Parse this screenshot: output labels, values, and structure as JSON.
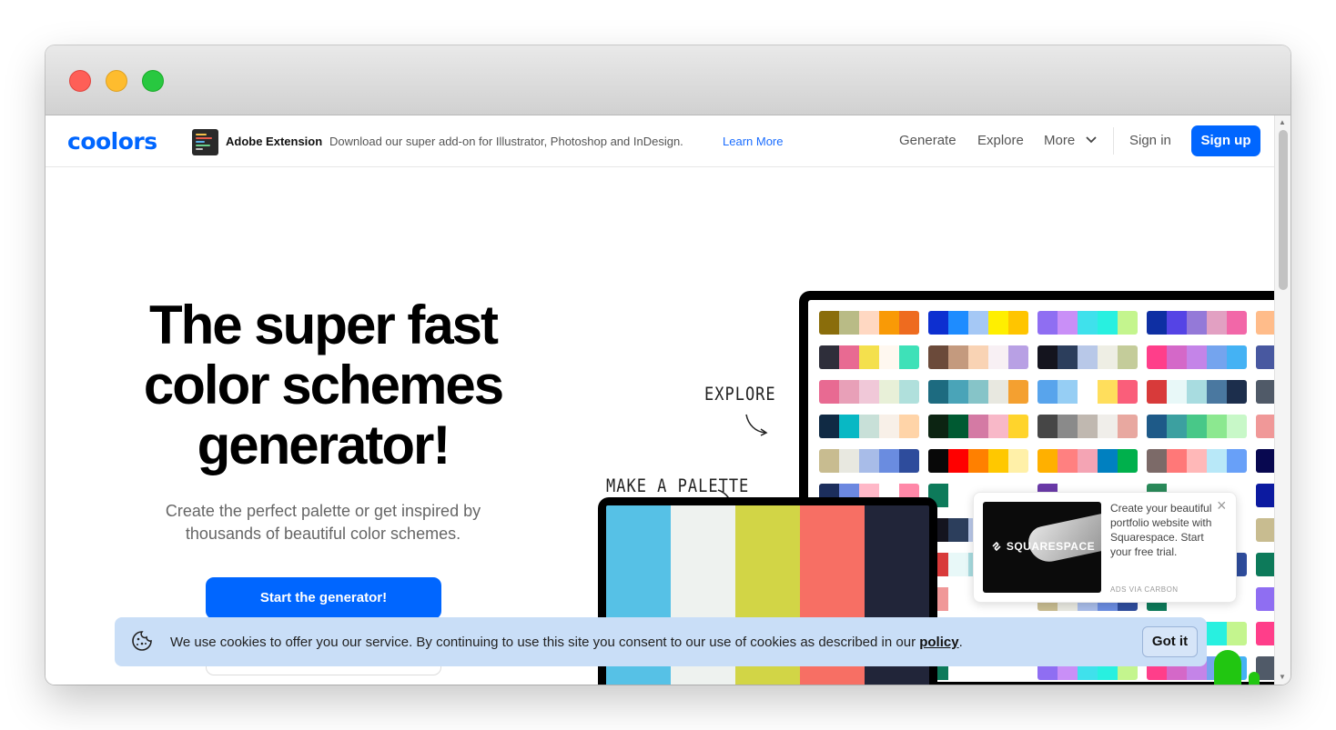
{
  "nav": {
    "logo": "coolors",
    "extension_title": "Adobe Extension",
    "extension_desc": "Download our super add-on for Illustrator, Photoshop and InDesign.",
    "extension_link": "Learn More",
    "links": [
      "Generate",
      "Explore",
      "More"
    ],
    "sign_in": "Sign in",
    "sign_up": "Sign up"
  },
  "hero": {
    "title_line1": "The super fast",
    "title_line2": "color schemes",
    "title_line3": "generator!",
    "subtitle_line1": "Create the perfect palette or get inspired by",
    "subtitle_line2": "thousands of beautiful color schemes.",
    "cta": "Start the generator!"
  },
  "illustration": {
    "label_explore": "EXPLORE",
    "label_make": "MAKE A PALETTE",
    "palette_colors": [
      "#56c1e6",
      "#eef2ef",
      "#d2d546",
      "#f76f64",
      "#212539"
    ],
    "grid": [
      [
        [
          "#8a6d0b",
          "#b9bb86",
          "#ffd8c2",
          "#f99a06",
          "#ee6b1f"
        ],
        [
          "#0d2fd0",
          "#1e8cff",
          "#a5c8f5",
          "#ffef00",
          "#ffc500"
        ],
        [
          "#8f6ef2",
          "#c98ff7",
          "#3fe1ec",
          "#28f0e0",
          "#c4f58e"
        ],
        [
          "#0e2fa3",
          "#5544e5",
          "#9479d8",
          "#e2a0c2",
          "#f267a8"
        ],
        [
          "#ffbc8a",
          "#f5e0c9",
          "#fff",
          "#fff",
          "#fff"
        ]
      ],
      [
        [
          "#2e2e3a",
          "#e86a92",
          "#f4e04d",
          "#fff8f0",
          "#3ee1b8"
        ],
        [
          "#6b4a3a",
          "#c49a7e",
          "#f9d3b4",
          "#f8f0f4",
          "#b8a0e4"
        ],
        [
          "#14141e",
          "#2c3e5c",
          "#b8c8e8",
          "#eeeee4",
          "#c4cc9a"
        ],
        [
          "#ff3e8a",
          "#d468c8",
          "#c484e8",
          "#74a4ee",
          "#44b2f4"
        ],
        [
          "#4858a0",
          "#fff",
          "#fff",
          "#fff",
          "#fff"
        ]
      ],
      [
        [
          "#e86a92",
          "#e8a0b8",
          "#f0c8d8",
          "#e8f0d8",
          "#b0e0dc"
        ],
        [
          "#1d6b80",
          "#4aa4b8",
          "#86c4c8",
          "#e8e8e0",
          "#f4a030"
        ],
        [
          "#58a4ec",
          "#96cef4",
          "#fff",
          "#ffde5c",
          "#fa5e7a"
        ],
        [
          "#d83a3a",
          "#e8f8f8",
          "#a8dce0",
          "#4a78a0",
          "#1c2e4c"
        ],
        [
          "#505a68",
          "#fff",
          "#fff",
          "#fff",
          "#fff"
        ]
      ],
      [
        [
          "#102a44",
          "#08b8c4",
          "#c8e0d8",
          "#f8f0e8",
          "#ffd4a8"
        ],
        [
          "#0c2412",
          "#005a32",
          "#d47aa4",
          "#f8b8c8",
          "#ffd42c"
        ],
        [
          "#464646",
          "#8a8a8a",
          "#c0b8b0",
          "#f0eeea",
          "#e8a8a0"
        ],
        [
          "#1e5a88",
          "#3ca0a0",
          "#48c888",
          "#8ce890",
          "#c8f8c8"
        ],
        [
          "#f09898",
          "#fff",
          "#fff",
          "#fff",
          "#fff"
        ]
      ],
      [
        [
          "#c8bc90",
          "#e8e8e0",
          "#a8bce8",
          "#6a8ce0",
          "#2e4c9c"
        ],
        [
          "#080808",
          "#ff0000",
          "#ff8000",
          "#ffc800",
          "#fff0a8"
        ],
        [
          "#ffb000",
          "#ff8080",
          "#f4a4b4",
          "#0080c0",
          "#00b04c"
        ],
        [
          "#7c6a68",
          "#ff7878",
          "#ffb8b8",
          "#b8e8f8",
          "#68a0f8"
        ],
        [
          "#080850",
          "#fff",
          "#fff",
          "#fff",
          "#fff"
        ]
      ],
      [
        [
          "#1c2e5c",
          "#6c88e0",
          "#ffb8c8",
          "#fff",
          "#ff88a8"
        ],
        [
          "#0d7a5a",
          "#fff",
          "#fff",
          "#fff",
          "#fff"
        ],
        [
          "#6a3aa8",
          "#fff",
          "#fff",
          "#fff",
          "#fff"
        ],
        [
          "#2a8a5a",
          "#fff",
          "#fff",
          "#fff",
          "#fff"
        ],
        [
          "#0c1aa0",
          "#fff",
          "#fff",
          "#fff",
          "#fff"
        ]
      ]
    ]
  },
  "ad": {
    "brand": "SQUARESPACE",
    "text": "Create your beautiful portfolio website with Squarespace. Start your free trial.",
    "via": "ADS VIA CARBON",
    "close": "×"
  },
  "cookie": {
    "text": "We use cookies to offer you our service. By continuing to use this site you consent to our use of cookies as described in our",
    "policy": "policy",
    "period": ".",
    "button": "Got it"
  },
  "icons": {
    "chevron": "chevron-down-icon",
    "cookie": "cookie-icon",
    "close": "close-icon"
  }
}
